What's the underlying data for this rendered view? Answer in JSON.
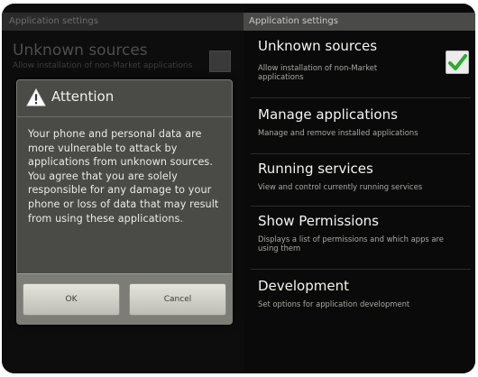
{
  "left": {
    "titlebar": "Application settings",
    "row_title": "Unknown sources",
    "row_sub": "Allow installation of non-Market applications"
  },
  "dialog": {
    "title": "Attention",
    "body": "Your phone and personal data are more vulnerable to attack by applications from unknown sources. You agree that you are solely responsible for any damage to your phone or loss of data that may result from using these applications.",
    "ok_label": "OK",
    "cancel_label": "Cancel"
  },
  "right": {
    "titlebar": "Application settings",
    "items": [
      {
        "title": "Unknown sources",
        "desc": "Allow installation of non-Market applications",
        "checked": true
      },
      {
        "title": "Manage applications",
        "desc": "Manage and remove installed applications"
      },
      {
        "title": "Running services",
        "desc": "View and control currently running services"
      },
      {
        "title": "Show Permissions",
        "desc": "Displays a list of permissions and which apps are using them"
      },
      {
        "title": "Development",
        "desc": "Set options for application development"
      }
    ]
  },
  "colors": {
    "check_green": "#2faa2f",
    "warning_icon": "#ffffff"
  },
  "icons": [
    "warning-icon",
    "checkmark-icon"
  ]
}
